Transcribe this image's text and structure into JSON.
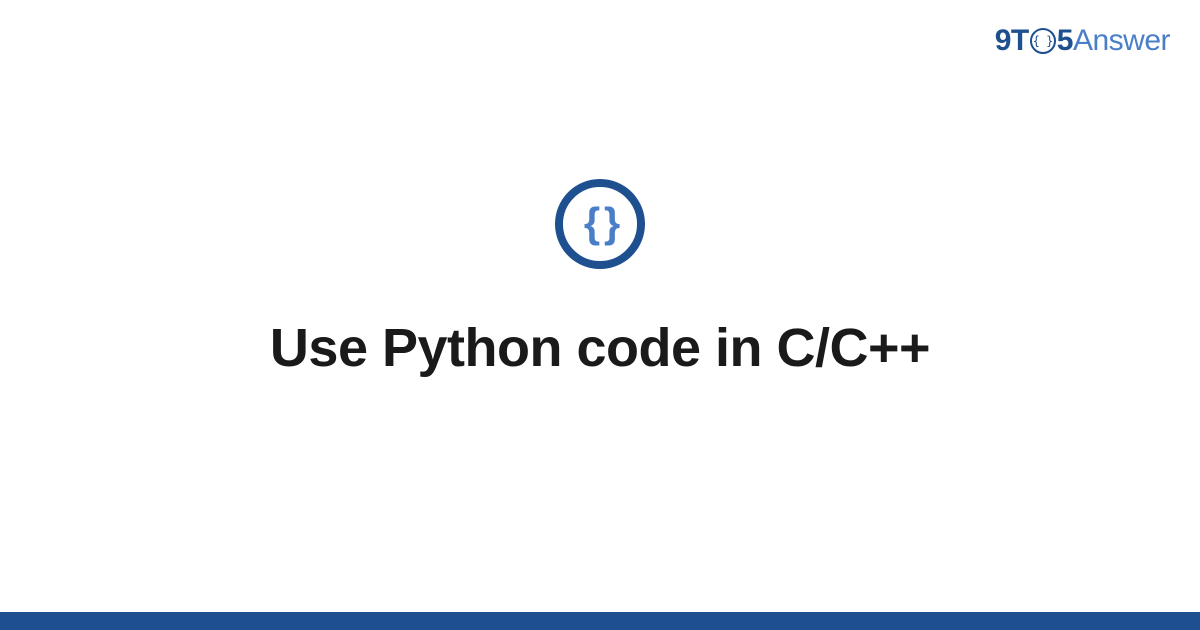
{
  "brand": {
    "part1": "9T",
    "part_o_inner": "{ }",
    "part2": "5",
    "part3": "Answer"
  },
  "icon": {
    "name": "code-braces-icon",
    "glyph": "{ }"
  },
  "title": "Use Python code in C/C++",
  "colors": {
    "primary": "#1e4f8f",
    "secondary": "#4a7fc8"
  }
}
